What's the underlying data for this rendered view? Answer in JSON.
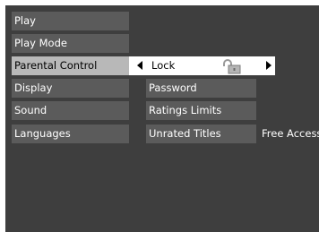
{
  "menu": {
    "items": [
      {
        "label": "Play"
      },
      {
        "label": "Play Mode"
      },
      {
        "label": "Parental Control"
      },
      {
        "label": "Display"
      },
      {
        "label": "Sound"
      },
      {
        "label": "Languages"
      }
    ],
    "selected": "Parental Control"
  },
  "submenu": {
    "lock": {
      "label": "Lock",
      "icon": "unlocked-padlock-icon"
    },
    "items": [
      {
        "label": "Password"
      },
      {
        "label": "Ratings Limits"
      },
      {
        "label": "Unrated Titles"
      }
    ],
    "unrated_titles_value": "Free Access"
  },
  "colors": {
    "background": "#3e3e3e",
    "menu_item": "#5b5b5b",
    "selected_item": "#b8b8b8",
    "focus_row": "#ffffff"
  }
}
